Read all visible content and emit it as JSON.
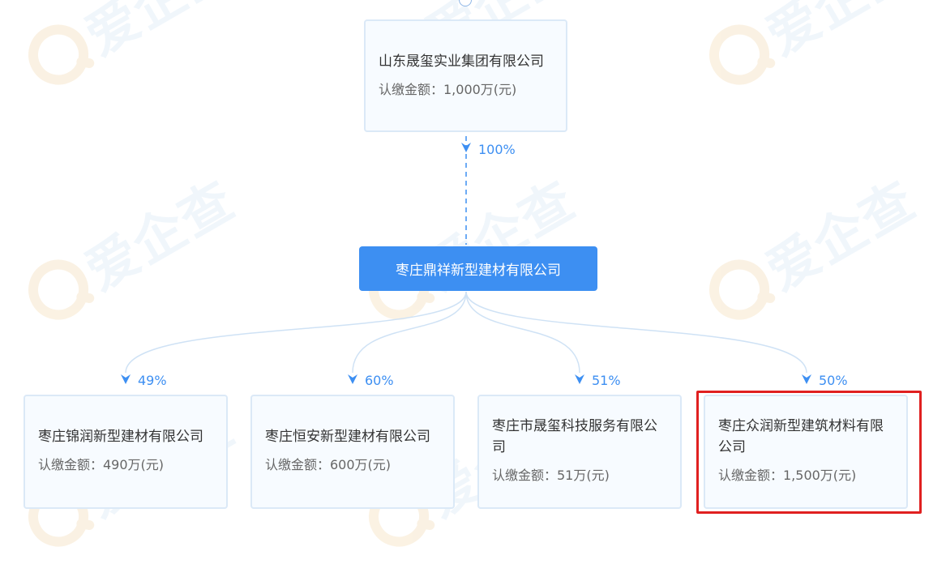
{
  "watermark": {
    "text": "爱企查"
  },
  "parent": {
    "name": "山东晟玺实业集团有限公司",
    "amount": "认缴金额：1,000万(元)",
    "percent": "100%"
  },
  "center": {
    "name": "枣庄鼎祥新型建材有限公司"
  },
  "children": [
    {
      "name": "枣庄锦润新型建材有限公司",
      "amount": "认缴金额：490万(元)",
      "percent": "49%"
    },
    {
      "name": "枣庄恒安新型建材有限公司",
      "amount": "认缴金额：600万(元)",
      "percent": "60%"
    },
    {
      "name": "枣庄市晟玺科技服务有限公司",
      "amount": "认缴金额：51万(元)",
      "percent": "51%"
    },
    {
      "name": "枣庄众润新型建筑材料有限公司",
      "amount": "认缴金额：1,500万(元)",
      "percent": "50%"
    }
  ],
  "colors": {
    "accent": "#3d8ff2",
    "node_bg": "#f7fbff",
    "node_border": "#dbe9f7",
    "link": "#cfe2f5",
    "highlight": "#e02020"
  }
}
